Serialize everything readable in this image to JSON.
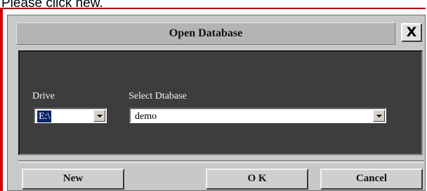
{
  "instruction": "Please click new.",
  "dialog": {
    "title": "Open Database",
    "close_label": "X",
    "drive_label": "Drive",
    "drive_value": "E:\\",
    "database_label": "Select Dtabase",
    "database_value": "demo",
    "buttons": {
      "new": "New",
      "ok": "O K",
      "cancel": "Cancel"
    }
  }
}
